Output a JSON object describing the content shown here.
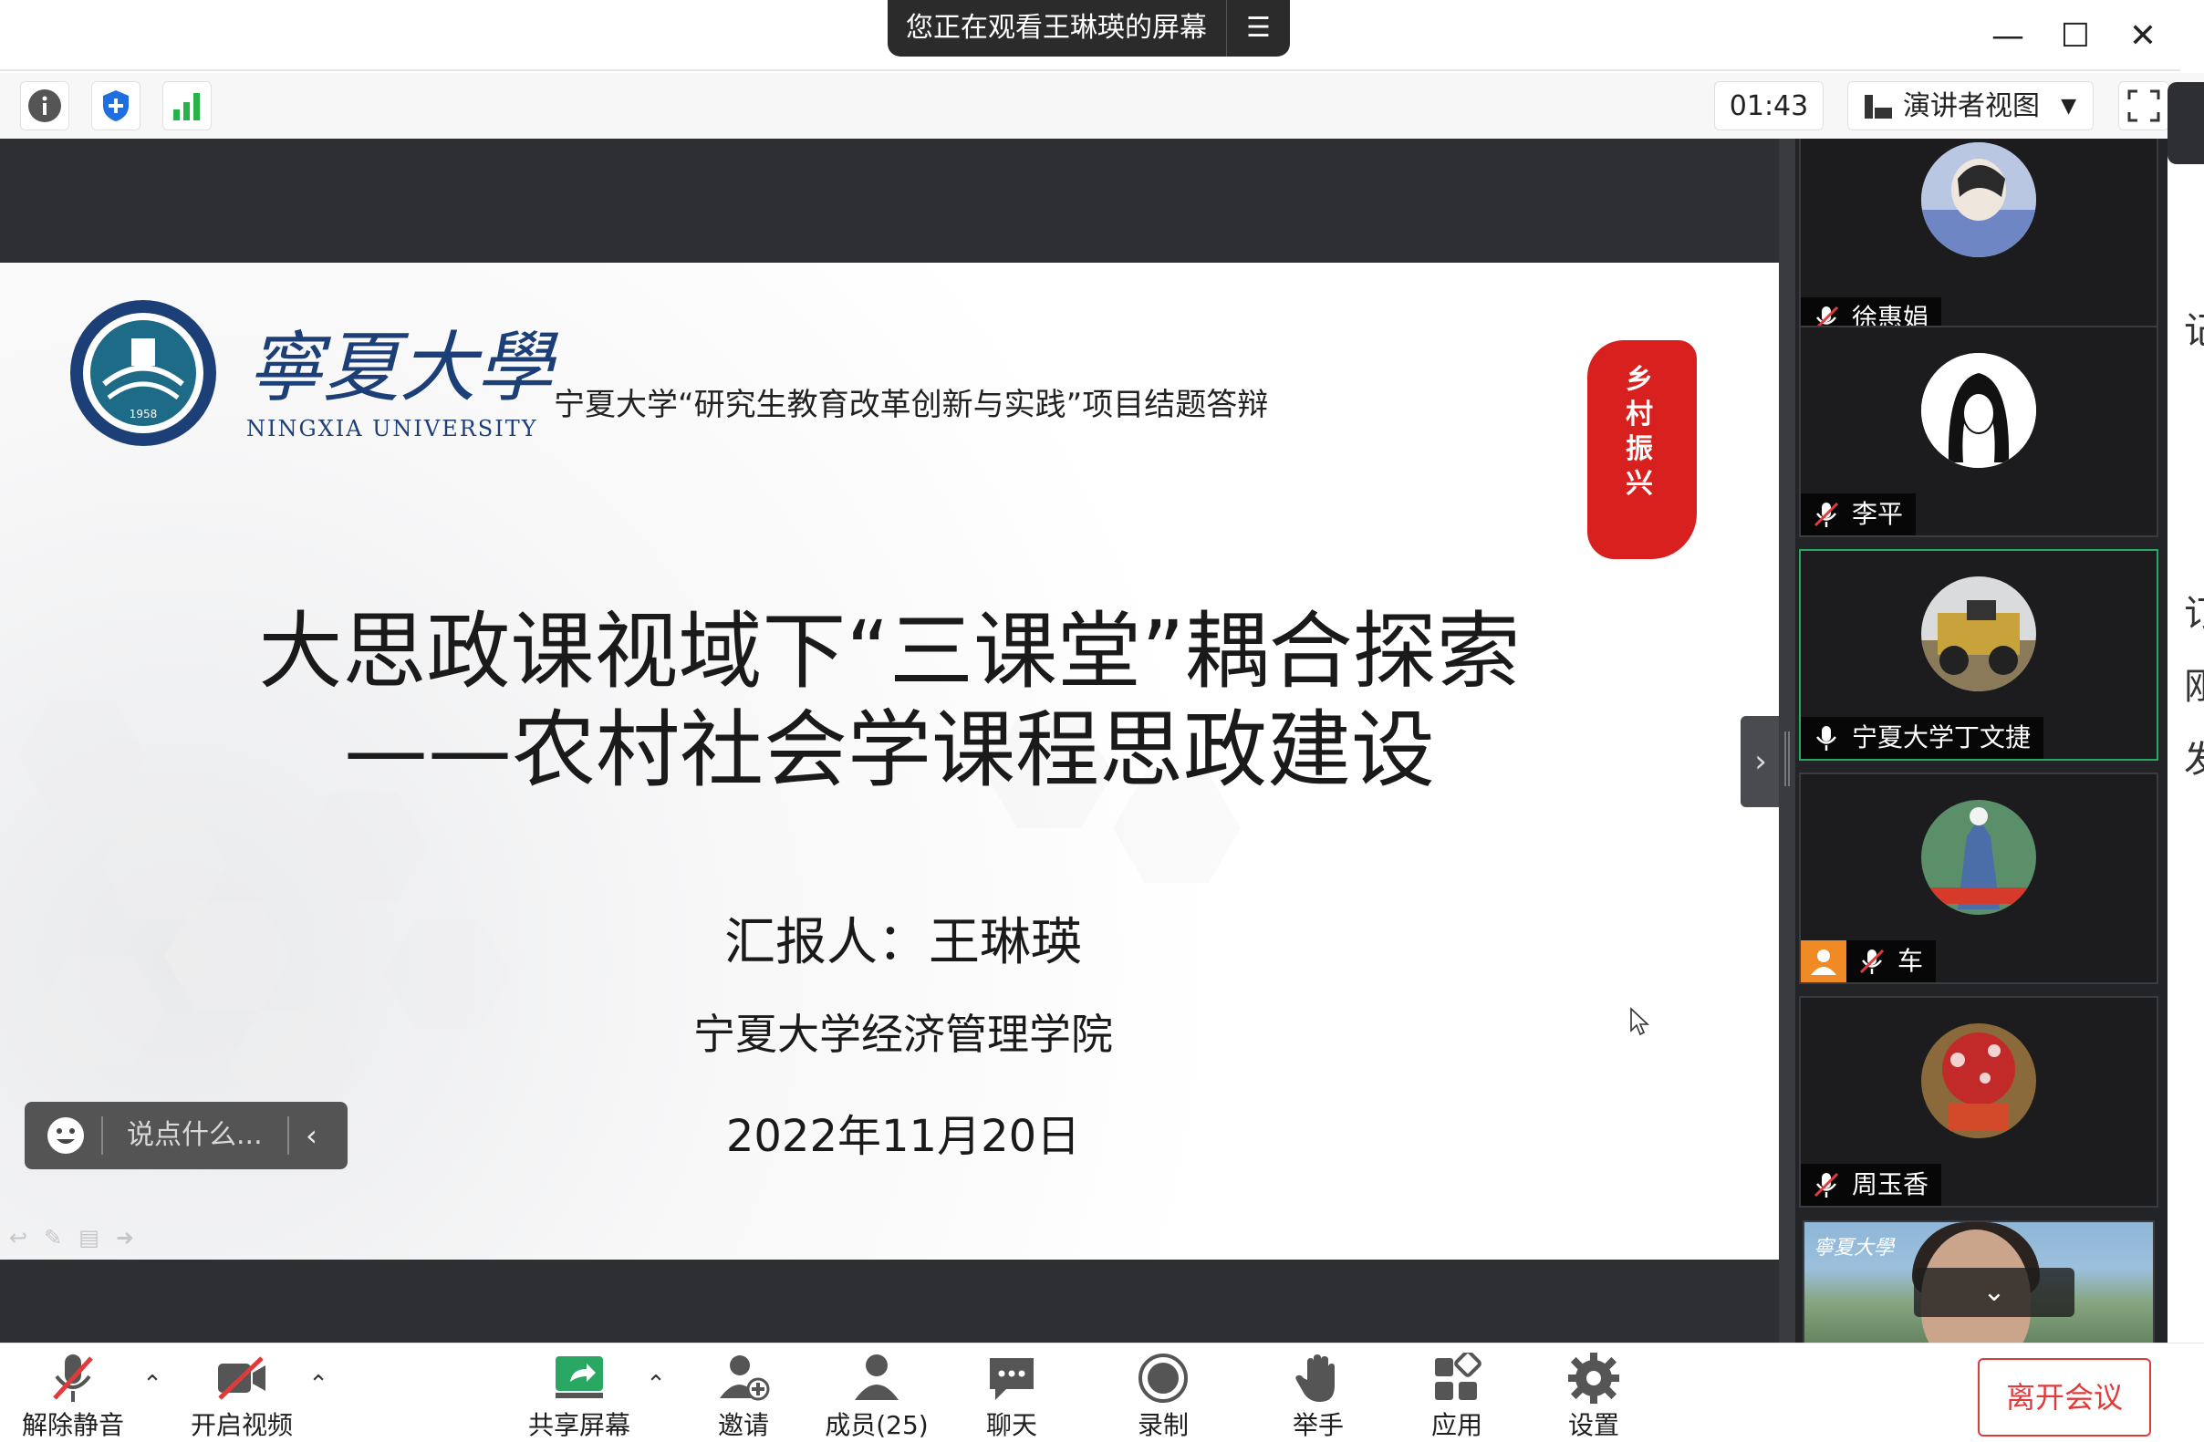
{
  "window": {
    "share_banner": "您正在观看王琳瑛的屏幕",
    "controls": [
      "—",
      "☐",
      "✕"
    ]
  },
  "toolbar": {
    "timer": "01:43",
    "view_mode": "演讲者视图"
  },
  "slide": {
    "university_cn": "寧夏大學",
    "university_en": "NINGXIA UNIVERSITY",
    "emblem_year": "1958",
    "subtitle": "宁夏大学“研究生教育改革创新与实践”项目结题答辩",
    "seal_text": "乡村振兴",
    "title_line1": "大思政课视域下“三课堂”耦合探索",
    "title_line2": "——农村社会学课程思政建设",
    "reporter": "汇报人：王琳瑛",
    "college": "宁夏大学经济管理学院",
    "date": "2022年11月20日"
  },
  "chat": {
    "placeholder": "说点什么..."
  },
  "participants": [
    {
      "name": "徐惠娟",
      "muted": true,
      "active": false,
      "host": false,
      "avatar_color": "#a8b8d8"
    },
    {
      "name": "李平",
      "muted": true,
      "active": false,
      "host": false,
      "avatar_color": "#ffffff"
    },
    {
      "name": "宁夏大学丁文捷",
      "muted": false,
      "active": true,
      "host": false,
      "avatar_color": "#b59a5a"
    },
    {
      "name": "车",
      "muted": true,
      "active": false,
      "host": true,
      "avatar_color": "#4f7f62"
    },
    {
      "name": "周玉香",
      "muted": true,
      "active": false,
      "host": false,
      "avatar_color": "#c22a2a"
    }
  ],
  "video_tile": {
    "logo": "寧夏大學"
  },
  "edge_chars": [
    "记",
    "订",
    "刚",
    "发"
  ],
  "bottom": {
    "unmute": "解除静音",
    "start_video": "开启视频",
    "share_screen": "共享屏幕",
    "invite": "邀请",
    "members": "成员(25)",
    "chat": "聊天",
    "record": "录制",
    "raise_hand": "举手",
    "apps": "应用",
    "settings": "设置",
    "leave": "离开会议"
  },
  "colors": {
    "accent_green": "#2aa863",
    "leave_red": "#e03b3b",
    "shield_blue": "#1f6fe0",
    "signal_green": "#27b34a",
    "university_blue": "#1d3f77"
  }
}
